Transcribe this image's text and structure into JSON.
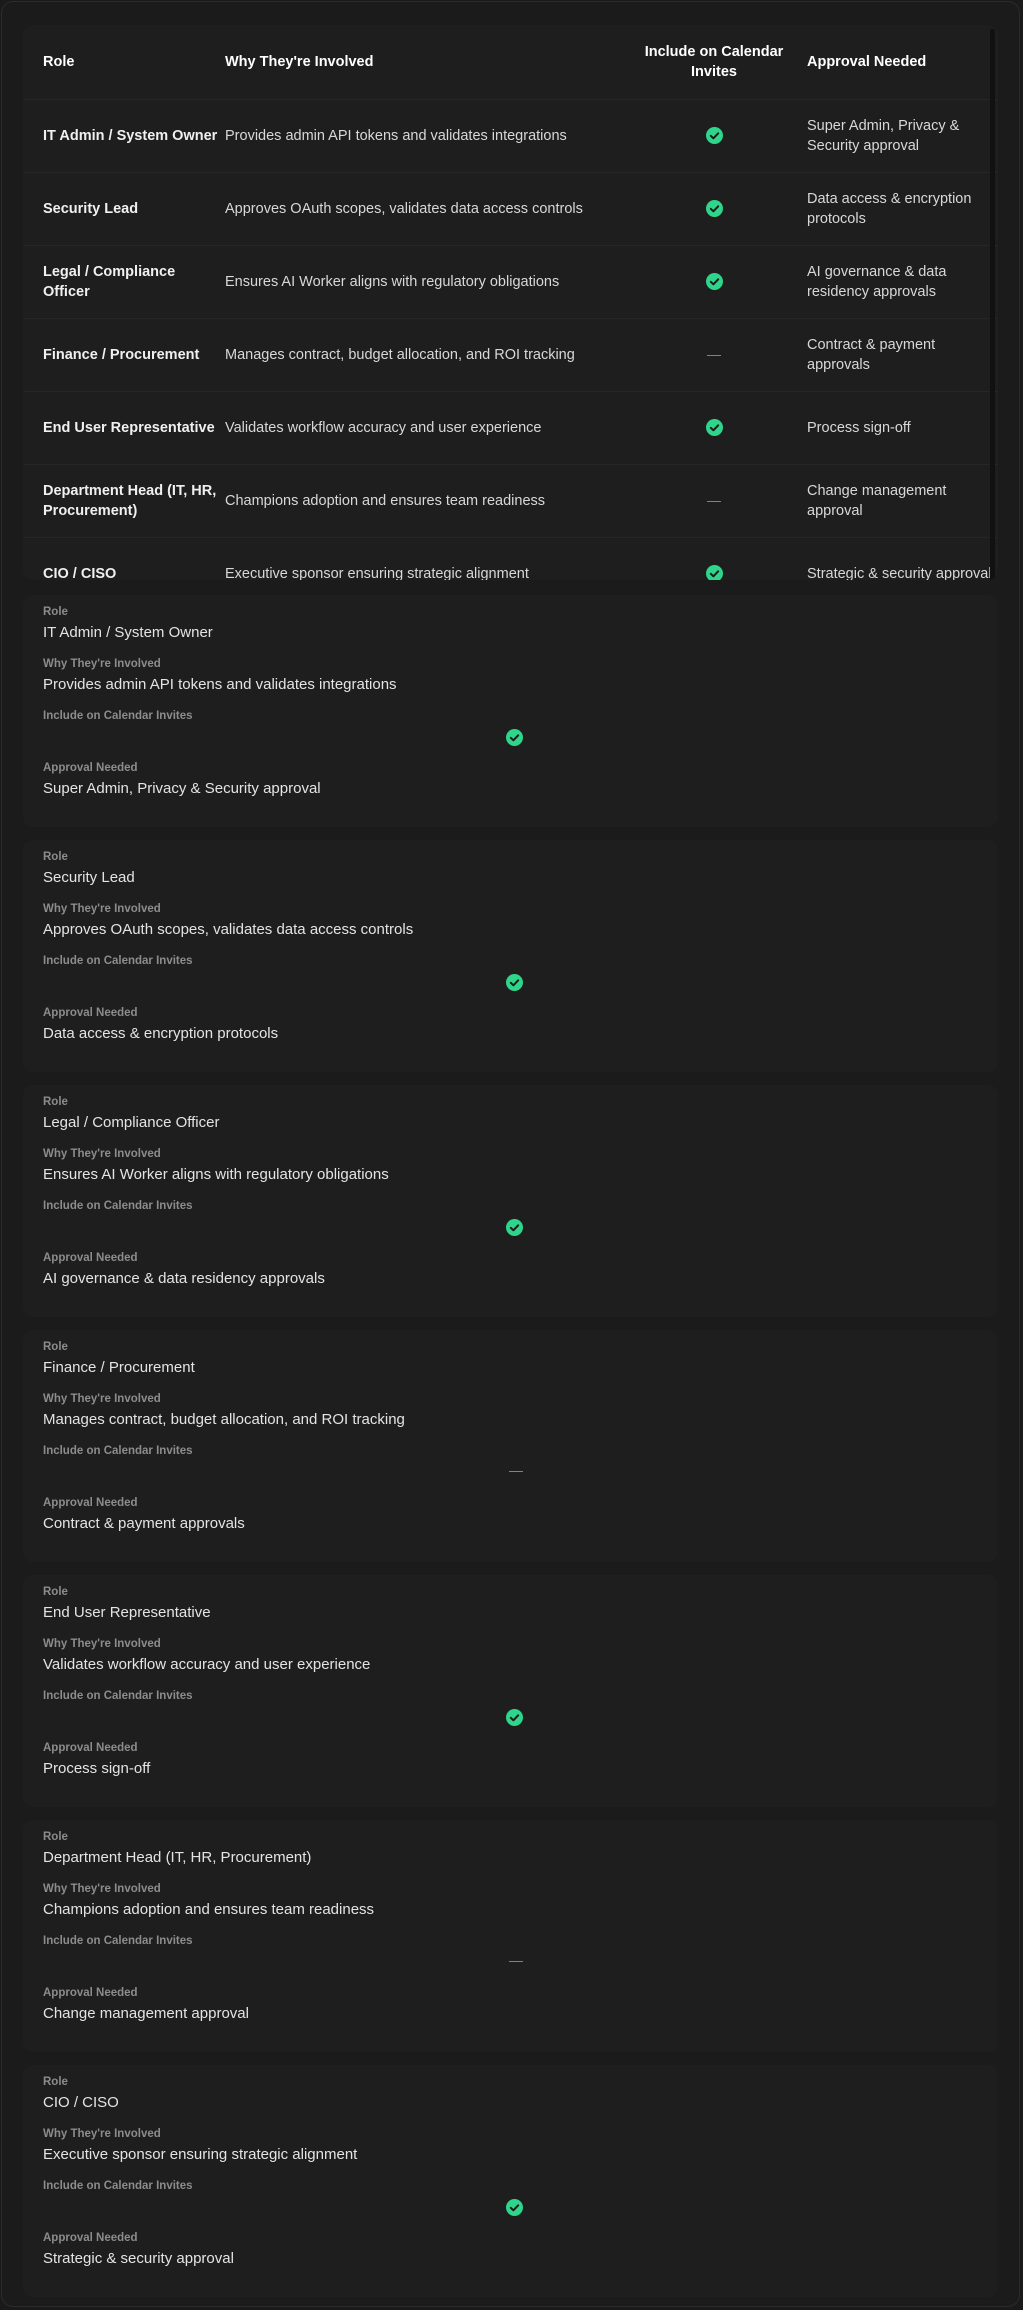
{
  "colors": {
    "background": "#1a1a1a",
    "panel": "#1e1e1e",
    "check_green": "#2fd58a",
    "label_gray": "#8c8c8c"
  },
  "table": {
    "headers": {
      "role": "Role",
      "why": "Why They're Involved",
      "calendar": "Include on Calendar Invites",
      "approval": "Approval Needed"
    },
    "rows": [
      {
        "role": "IT Admin / System Owner",
        "why": "Provides admin API tokens and validates integrations",
        "calendar": "check-icon",
        "approval": "Super Admin, Privacy & Security approval"
      },
      {
        "role": "Security Lead",
        "why": "Approves OAuth scopes, validates data access controls",
        "calendar": "check-icon",
        "approval": "Data access & encryption protocols"
      },
      {
        "role": "Legal / Compliance Officer",
        "why": "Ensures AI Worker aligns with regulatory obligations",
        "calendar": "check-icon",
        "approval": "AI governance & data residency approvals"
      },
      {
        "role": "Finance / Procurement",
        "why": "Manages contract, budget allocation, and ROI tracking",
        "calendar": "—",
        "approval": "Contract & payment approvals"
      },
      {
        "role": "End User Representative",
        "why": "Validates workflow accuracy and user experience",
        "calendar": "check-icon",
        "approval": "Process sign-off"
      },
      {
        "role": "Department Head (IT, HR, Procurement)",
        "why": "Champions adoption and ensures team readiness",
        "calendar": "—",
        "approval": "Change management approval"
      },
      {
        "role": "CIO / CISO",
        "why": "Executive sponsor ensuring strategic alignment",
        "calendar": "check-icon",
        "approval": "Strategic & security approval"
      }
    ]
  },
  "cards": {
    "labels": {
      "role": "Role",
      "why": "Why They're Involved",
      "calendar": "Include on Calendar Invites",
      "approval": "Approval Needed"
    },
    "items": [
      {
        "role": "IT Admin / System Owner",
        "why": "Provides admin API tokens and validates integrations",
        "calendar": "check-icon",
        "approval": "Super Admin, Privacy & Security approval"
      },
      {
        "role": "Security Lead",
        "why": "Approves OAuth scopes, validates data access controls",
        "calendar": "check-icon",
        "approval": "Data access & encryption protocols"
      },
      {
        "role": "Legal / Compliance Officer",
        "why": "Ensures AI Worker aligns with regulatory obligations",
        "calendar": "check-icon",
        "approval": "AI governance & data residency approvals"
      },
      {
        "role": "Finance / Procurement",
        "why": "Manages contract, budget allocation, and ROI tracking",
        "calendar": "—",
        "approval": "Contract & payment approvals"
      },
      {
        "role": "End User Representative",
        "why": "Validates workflow accuracy and user experience",
        "calendar": "check-icon",
        "approval": "Process sign-off"
      },
      {
        "role": "Department Head (IT, HR, Procurement)",
        "why": "Champions adoption and ensures team readiness",
        "calendar": "—",
        "approval": "Change management approval"
      },
      {
        "role": "CIO / CISO",
        "why": "Executive sponsor ensuring strategic alignment",
        "calendar": "check-icon",
        "approval": "Strategic & security approval"
      }
    ]
  }
}
